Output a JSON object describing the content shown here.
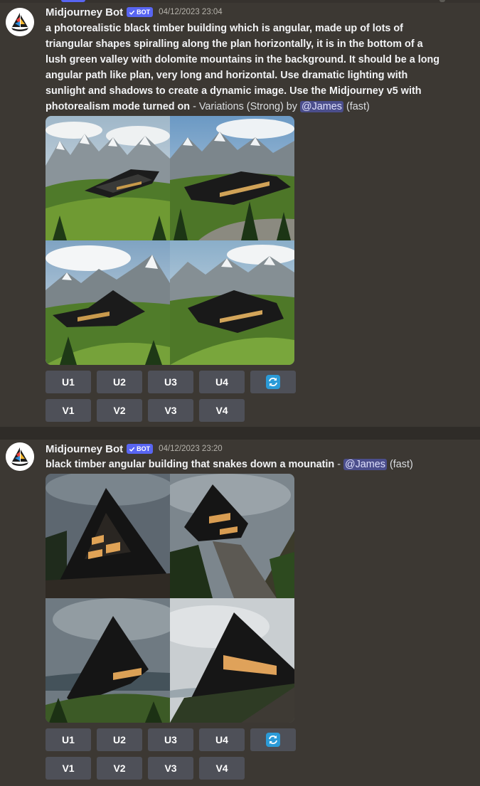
{
  "messages": [
    {
      "username": "Midjourney Bot",
      "bot_tag": "BOT",
      "timestamp": "04/12/2023 23:04",
      "prompt": "a photorealistic black timber building which is angular, made up of lots of triangular shapes spiralling along the plan horizontally, it is in the bottom of a lush green valley with dolomite mountains in the background. It should be a long angular path like plan, very long and horizontal. Use dramatic lighting with sunlight and shadows to create a dynamic image. Use the Midjourney v5 with photorealism mode turned on",
      "meta_prefix": " - Variations (Strong) by ",
      "mention": "@James",
      "meta_suffix": " (fast)",
      "upscale_buttons": [
        "U1",
        "U2",
        "U3",
        "U4"
      ],
      "variation_buttons": [
        "V1",
        "V2",
        "V3",
        "V4"
      ],
      "reroll_icon": "refresh-icon"
    },
    {
      "username": "Midjourney Bot",
      "bot_tag": "BOT",
      "timestamp": "04/12/2023 23:20",
      "prompt": "black timber angular building that snakes down a mounatin",
      "meta_prefix": " - ",
      "mention": "@James",
      "meta_suffix": " (fast)",
      "upscale_buttons": [
        "U1",
        "U2",
        "U3",
        "U4"
      ],
      "variation_buttons": [
        "V1",
        "V2",
        "V3",
        "V4"
      ],
      "reroll_icon": "refresh-icon"
    }
  ],
  "colors": {
    "background": "#3c3833",
    "button": "#4e5058",
    "bot_tag": "#5865f2",
    "mention_bg": "#4b4e8c",
    "reroll_icon": "#2b9bd8"
  }
}
